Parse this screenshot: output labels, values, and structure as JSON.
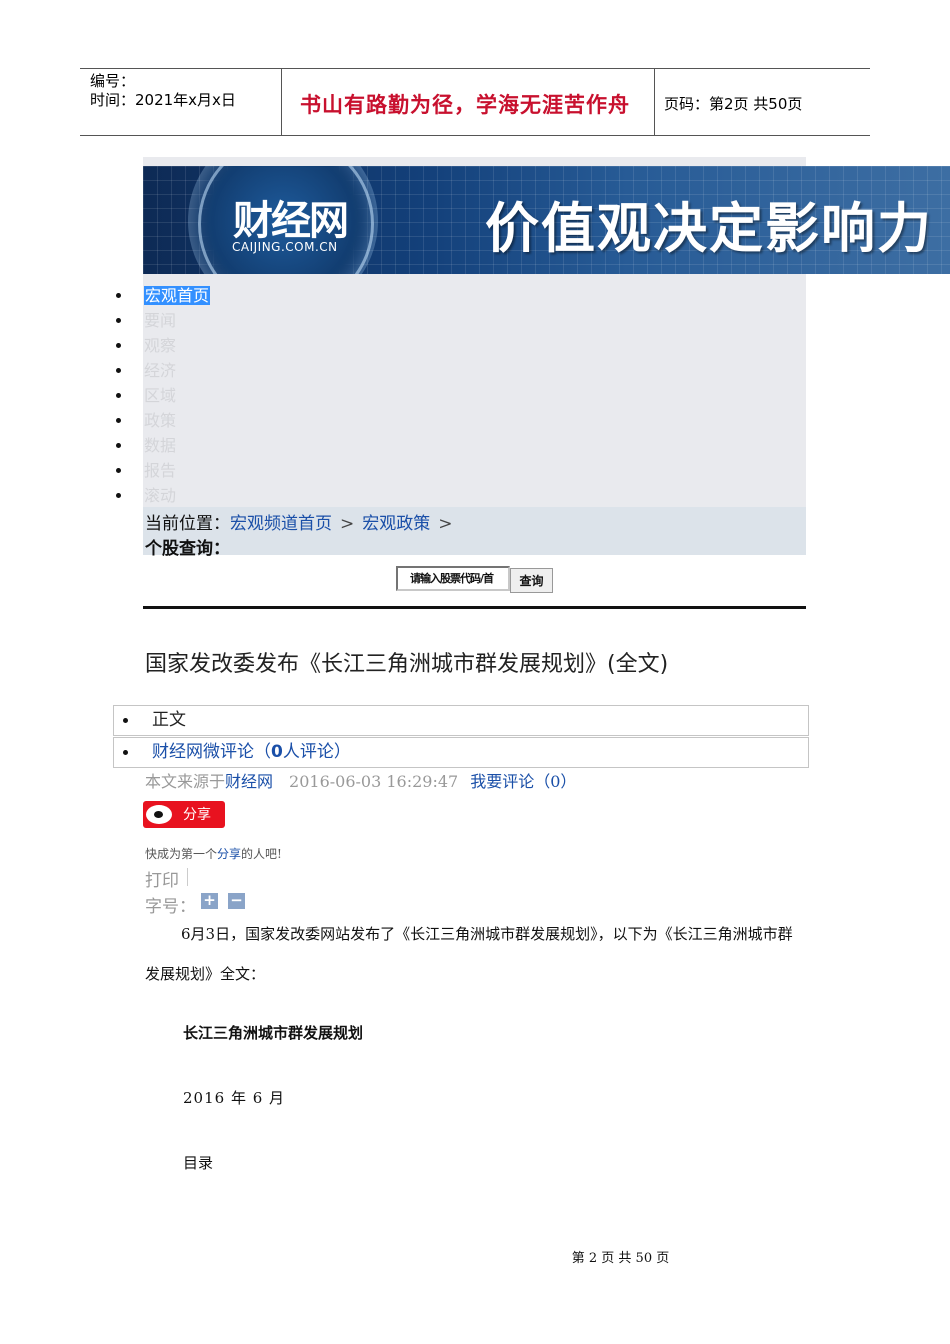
{
  "header": {
    "serial_label": "编号：",
    "time_label": "时间：2021年x月x日",
    "motto": "书山有路勤为径，学海无涯苦作舟",
    "page_info": "页码：第2页 共50页"
  },
  "banner": {
    "logo_cn": "财经网",
    "logo_en": "CAIJING.COM.CN",
    "slogan": "价值观决定影响力"
  },
  "nav": {
    "items": [
      "宏观首页",
      "要闻",
      "观察",
      "经济",
      "区域",
      "政策",
      "数据",
      "报告",
      "滚动"
    ],
    "active_index": 0
  },
  "breadcrumb": {
    "label": "当前位置：",
    "items": [
      "宏观频道首页",
      "宏观政策"
    ],
    "separator": ">"
  },
  "stock_search": {
    "label": "个股查询：",
    "placeholder": "请输入股票代码/首",
    "button": "查询"
  },
  "article": {
    "title": "国家发改委发布《长江三角洲城市群发展规划》(全文)",
    "tabs": {
      "body": "正文",
      "comments_prefix": "财经网微评论（",
      "comments_count": "0",
      "comments_suffix": "人评论）"
    },
    "meta": {
      "source_prefix": "本文来源于",
      "source_name": "财经网",
      "datetime": "2016-06-03 16:29:47",
      "comment_link": "我要评论（0）"
    },
    "share": {
      "button": "分享",
      "note_prefix": "快成为第一个",
      "note_link": "分享",
      "note_suffix": "的人吧!"
    },
    "print_label": "打印",
    "font_size_label": "字号：",
    "font_plus": "+",
    "font_minus": "−",
    "paragraph": "6月3日，国家发改委网站发布了《长江三角洲城市群发展规划》，以下为《长江三角洲城市群发展规划》全文：",
    "doc_title": "长江三角洲城市群发展规划",
    "doc_date": "2016 年 6 月",
    "toc_label": "目录"
  },
  "footer": {
    "text": "第 2 页 共 50 页"
  }
}
